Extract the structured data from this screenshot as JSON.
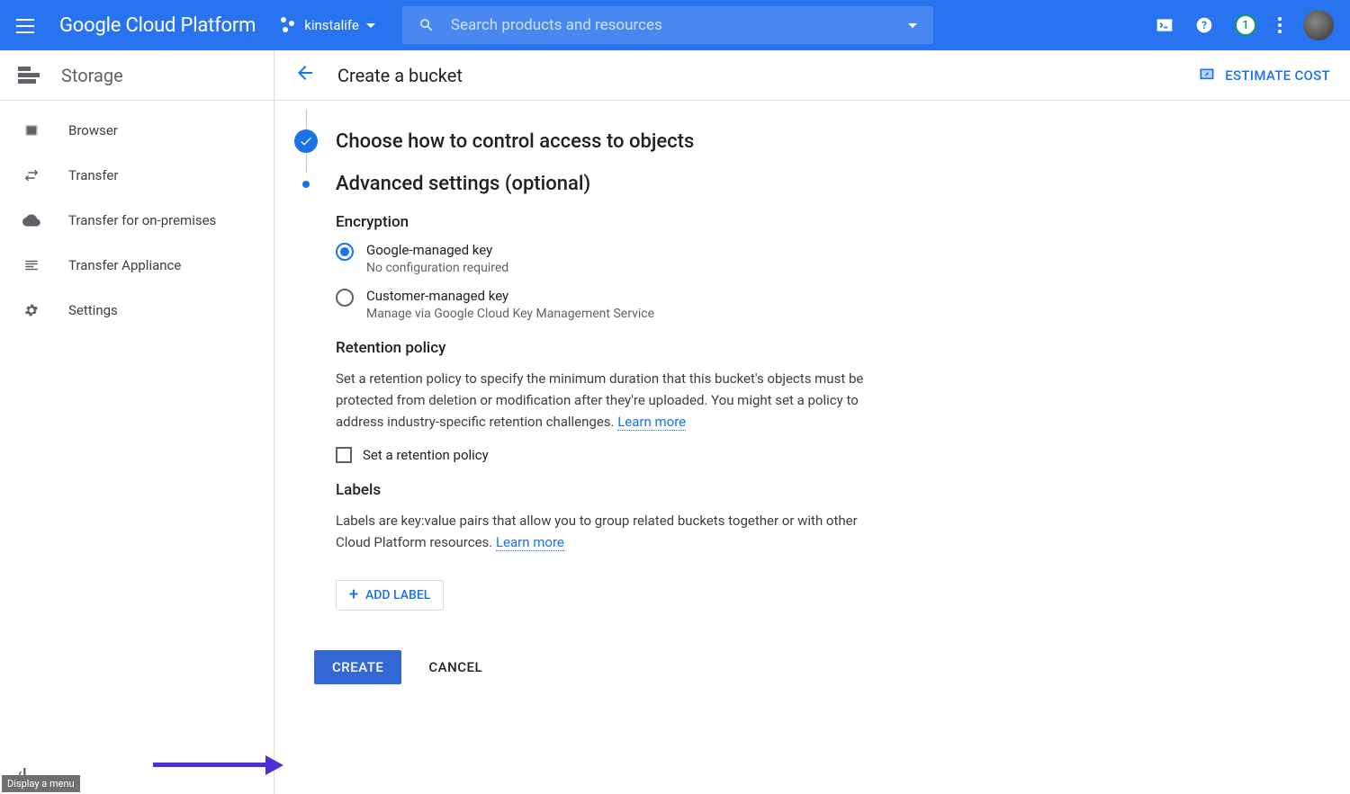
{
  "header": {
    "logo": "Google Cloud Platform",
    "project_name": "kinstalife",
    "search_placeholder": "Search products and resources",
    "notification_count": "1"
  },
  "sidebar": {
    "title": "Storage",
    "items": [
      {
        "icon": "browser",
        "label": "Browser"
      },
      {
        "icon": "transfer",
        "label": "Transfer"
      },
      {
        "icon": "cloud-upload",
        "label": "Transfer for on-premises"
      },
      {
        "icon": "appliance",
        "label": "Transfer Appliance"
      },
      {
        "icon": "gear",
        "label": "Settings"
      }
    ]
  },
  "content": {
    "page_title": "Create a bucket",
    "estimate_label": "ESTIMATE COST",
    "step_completed_title": "Choose how to control access to objects",
    "step_active_title": "Advanced settings (optional)",
    "encryption": {
      "heading": "Encryption",
      "option1_title": "Google-managed key",
      "option1_sub": "No configuration required",
      "option2_title": "Customer-managed key",
      "option2_sub": "Manage via Google Cloud Key Management Service"
    },
    "retention": {
      "heading": "Retention policy",
      "desc_a": "Set a retention policy to specify the minimum duration that this bucket's objects must be protected from deletion or modification after they're uploaded. You might set a policy to address industry-specific retention challenges. ",
      "learn_more": "Learn more",
      "checkbox_label": "Set a retention policy"
    },
    "labels": {
      "heading": "Labels",
      "desc_a": "Labels are key:value pairs that allow you to group related buckets together or with other Cloud Platform resources. ",
      "learn_more": "Learn more",
      "add_button": "ADD LABEL"
    },
    "actions": {
      "create": "CREATE",
      "cancel": "CANCEL"
    }
  },
  "tooltip": "Display a menu"
}
